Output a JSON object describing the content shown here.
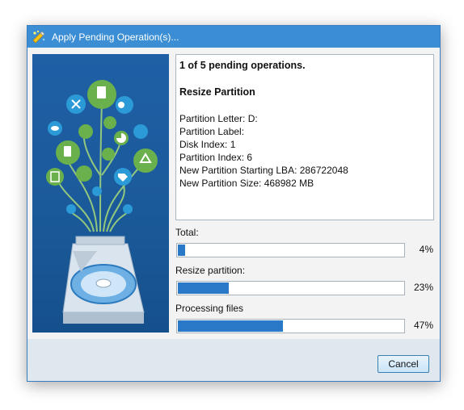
{
  "window": {
    "title": "Apply Pending Operation(s)..."
  },
  "info": {
    "progress_text": "1 of 5 pending operations.",
    "operation": "Resize Partition",
    "details": [
      "Partition Letter: D:",
      "Partition Label:",
      "Disk Index: 1",
      "Partition Index: 6",
      "New Partition Starting LBA: 286722048",
      "New Partition Size: 468982 MB"
    ]
  },
  "progress": [
    {
      "label": "Total:",
      "percent_text": "4%",
      "value": 0.04
    },
    {
      "label": "Resize partition:",
      "percent_text": "23%",
      "value": 0.23
    },
    {
      "label": "Processing files",
      "percent_text": "47%",
      "value": 0.47
    }
  ],
  "buttons": {
    "cancel": "Cancel"
  },
  "colors": {
    "accent": "#3b8ed4",
    "progress_fill": "#2a78c8",
    "art_bg": "#1f5fa5",
    "bubble_green": "#6ab04c"
  },
  "icons": [
    "app-wizard-icon",
    "disk-illustration",
    "recycle-icon",
    "document-icon",
    "chart-icon",
    "tag-icon",
    "eye-icon",
    "grid-icon"
  ]
}
